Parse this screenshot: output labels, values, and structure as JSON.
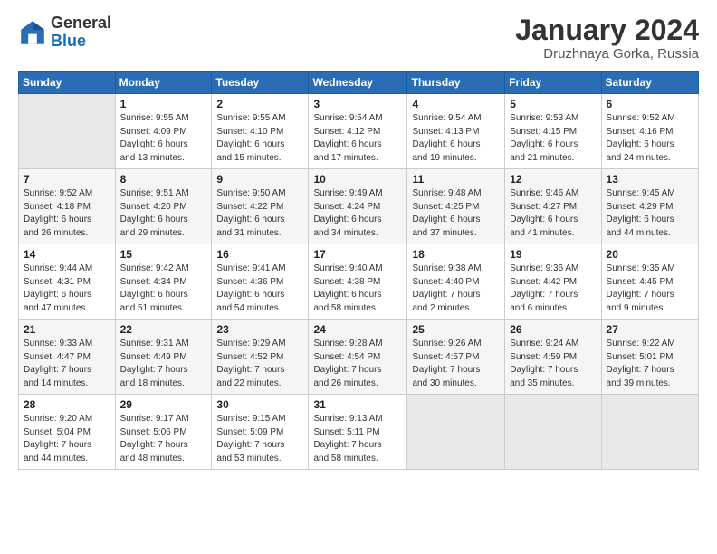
{
  "header": {
    "logo_general": "General",
    "logo_blue": "Blue",
    "month_title": "January 2024",
    "location": "Druzhnaya Gorka, Russia"
  },
  "days_of_week": [
    "Sunday",
    "Monday",
    "Tuesday",
    "Wednesday",
    "Thursday",
    "Friday",
    "Saturday"
  ],
  "weeks": [
    [
      {
        "day": "",
        "info": ""
      },
      {
        "day": "1",
        "info": "Sunrise: 9:55 AM\nSunset: 4:09 PM\nDaylight: 6 hours\nand 13 minutes."
      },
      {
        "day": "2",
        "info": "Sunrise: 9:55 AM\nSunset: 4:10 PM\nDaylight: 6 hours\nand 15 minutes."
      },
      {
        "day": "3",
        "info": "Sunrise: 9:54 AM\nSunset: 4:12 PM\nDaylight: 6 hours\nand 17 minutes."
      },
      {
        "day": "4",
        "info": "Sunrise: 9:54 AM\nSunset: 4:13 PM\nDaylight: 6 hours\nand 19 minutes."
      },
      {
        "day": "5",
        "info": "Sunrise: 9:53 AM\nSunset: 4:15 PM\nDaylight: 6 hours\nand 21 minutes."
      },
      {
        "day": "6",
        "info": "Sunrise: 9:52 AM\nSunset: 4:16 PM\nDaylight: 6 hours\nand 24 minutes."
      }
    ],
    [
      {
        "day": "7",
        "info": "Sunrise: 9:52 AM\nSunset: 4:18 PM\nDaylight: 6 hours\nand 26 minutes."
      },
      {
        "day": "8",
        "info": "Sunrise: 9:51 AM\nSunset: 4:20 PM\nDaylight: 6 hours\nand 29 minutes."
      },
      {
        "day": "9",
        "info": "Sunrise: 9:50 AM\nSunset: 4:22 PM\nDaylight: 6 hours\nand 31 minutes."
      },
      {
        "day": "10",
        "info": "Sunrise: 9:49 AM\nSunset: 4:24 PM\nDaylight: 6 hours\nand 34 minutes."
      },
      {
        "day": "11",
        "info": "Sunrise: 9:48 AM\nSunset: 4:25 PM\nDaylight: 6 hours\nand 37 minutes."
      },
      {
        "day": "12",
        "info": "Sunrise: 9:46 AM\nSunset: 4:27 PM\nDaylight: 6 hours\nand 41 minutes."
      },
      {
        "day": "13",
        "info": "Sunrise: 9:45 AM\nSunset: 4:29 PM\nDaylight: 6 hours\nand 44 minutes."
      }
    ],
    [
      {
        "day": "14",
        "info": "Sunrise: 9:44 AM\nSunset: 4:31 PM\nDaylight: 6 hours\nand 47 minutes."
      },
      {
        "day": "15",
        "info": "Sunrise: 9:42 AM\nSunset: 4:34 PM\nDaylight: 6 hours\nand 51 minutes."
      },
      {
        "day": "16",
        "info": "Sunrise: 9:41 AM\nSunset: 4:36 PM\nDaylight: 6 hours\nand 54 minutes."
      },
      {
        "day": "17",
        "info": "Sunrise: 9:40 AM\nSunset: 4:38 PM\nDaylight: 6 hours\nand 58 minutes."
      },
      {
        "day": "18",
        "info": "Sunrise: 9:38 AM\nSunset: 4:40 PM\nDaylight: 7 hours\nand 2 minutes."
      },
      {
        "day": "19",
        "info": "Sunrise: 9:36 AM\nSunset: 4:42 PM\nDaylight: 7 hours\nand 6 minutes."
      },
      {
        "day": "20",
        "info": "Sunrise: 9:35 AM\nSunset: 4:45 PM\nDaylight: 7 hours\nand 9 minutes."
      }
    ],
    [
      {
        "day": "21",
        "info": "Sunrise: 9:33 AM\nSunset: 4:47 PM\nDaylight: 7 hours\nand 14 minutes."
      },
      {
        "day": "22",
        "info": "Sunrise: 9:31 AM\nSunset: 4:49 PM\nDaylight: 7 hours\nand 18 minutes."
      },
      {
        "day": "23",
        "info": "Sunrise: 9:29 AM\nSunset: 4:52 PM\nDaylight: 7 hours\nand 22 minutes."
      },
      {
        "day": "24",
        "info": "Sunrise: 9:28 AM\nSunset: 4:54 PM\nDaylight: 7 hours\nand 26 minutes."
      },
      {
        "day": "25",
        "info": "Sunrise: 9:26 AM\nSunset: 4:57 PM\nDaylight: 7 hours\nand 30 minutes."
      },
      {
        "day": "26",
        "info": "Sunrise: 9:24 AM\nSunset: 4:59 PM\nDaylight: 7 hours\nand 35 minutes."
      },
      {
        "day": "27",
        "info": "Sunrise: 9:22 AM\nSunset: 5:01 PM\nDaylight: 7 hours\nand 39 minutes."
      }
    ],
    [
      {
        "day": "28",
        "info": "Sunrise: 9:20 AM\nSunset: 5:04 PM\nDaylight: 7 hours\nand 44 minutes."
      },
      {
        "day": "29",
        "info": "Sunrise: 9:17 AM\nSunset: 5:06 PM\nDaylight: 7 hours\nand 48 minutes."
      },
      {
        "day": "30",
        "info": "Sunrise: 9:15 AM\nSunset: 5:09 PM\nDaylight: 7 hours\nand 53 minutes."
      },
      {
        "day": "31",
        "info": "Sunrise: 9:13 AM\nSunset: 5:11 PM\nDaylight: 7 hours\nand 58 minutes."
      },
      {
        "day": "",
        "info": ""
      },
      {
        "day": "",
        "info": ""
      },
      {
        "day": "",
        "info": ""
      }
    ]
  ]
}
